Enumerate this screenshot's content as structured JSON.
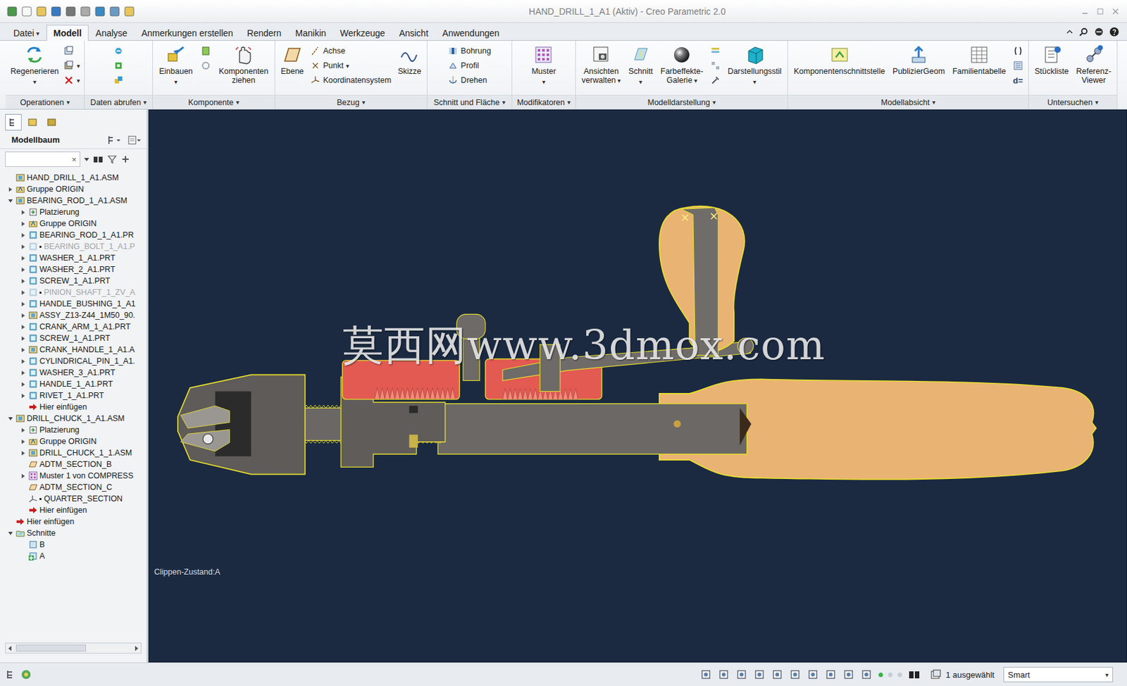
{
  "window": {
    "title": "HAND_DRILL_1_A1 (Aktiv) - Creo Parametric 2.0"
  },
  "menu_tabs": [
    {
      "label": "Datei",
      "menu": "▾",
      "selected": false
    },
    {
      "label": "Modell",
      "selected": true
    },
    {
      "label": "Analyse",
      "selected": false
    },
    {
      "label": "Anmerkungen erstellen",
      "selected": false
    },
    {
      "label": "Rendern",
      "selected": false
    },
    {
      "label": "Manikin",
      "selected": false
    },
    {
      "label": "Werkzeuge",
      "selected": false
    },
    {
      "label": "Ansicht",
      "selected": false
    },
    {
      "label": "Anwendungen",
      "selected": false
    }
  ],
  "ribbon": {
    "groups": [
      {
        "label": "Operationen",
        "menu": "▾",
        "items": [
          {
            "kind": "large",
            "label": "Regenerieren",
            "menu": "▾"
          },
          {
            "kind": "icon"
          },
          {
            "kind": "icon",
            "menu": "▾"
          },
          {
            "kind": "icon",
            "menu": "▾"
          }
        ]
      },
      {
        "label": "Daten abrufen",
        "menu": "▾",
        "items": [
          {
            "kind": "icon"
          },
          {
            "kind": "icon"
          },
          {
            "kind": "icon"
          }
        ]
      },
      {
        "label": "Komponente",
        "menu": "▾",
        "items": [
          {
            "kind": "large",
            "label": "Einbauen",
            "menu": "▾"
          },
          {
            "kind": "icon"
          },
          {
            "kind": "icon"
          },
          {
            "kind": "large",
            "label": "Komponenten\nziehen"
          }
        ]
      },
      {
        "label": "Bezug",
        "menu": "▾",
        "items": [
          {
            "kind": "large",
            "label": "Ebene"
          },
          {
            "kind": "small",
            "label": "Achse"
          },
          {
            "kind": "small",
            "label": "Punkt",
            "menu": "▾"
          },
          {
            "kind": "small",
            "label": "Koordinatensystem"
          },
          {
            "kind": "large",
            "label": "Skizze"
          }
        ]
      },
      {
        "label": "Schnitt und Fläche",
        "menu": "▾",
        "items": [
          {
            "kind": "small",
            "label": "Bohrung"
          },
          {
            "kind": "small",
            "label": "Profil"
          },
          {
            "kind": "small",
            "label": "Drehen"
          }
        ]
      },
      {
        "label": "Modifikatoren",
        "menu": "▾",
        "items": [
          {
            "kind": "large",
            "label": "Muster",
            "menu": "▾"
          }
        ]
      },
      {
        "label": "Modelldarstellung",
        "menu": "▾",
        "items": [
          {
            "kind": "large",
            "label": "Ansichten\nverwalten",
            "menu": "▾"
          },
          {
            "kind": "large",
            "label": "Schnitt",
            "menu": "▾"
          },
          {
            "kind": "large",
            "label": "Farbeffekte-\nGalerie",
            "menu": "▾"
          },
          {
            "kind": "icon"
          },
          {
            "kind": "icon"
          },
          {
            "kind": "icon"
          },
          {
            "kind": "large",
            "label": "Darstellungsstil",
            "menu": "▾"
          }
        ]
      },
      {
        "label": "Modellabsicht",
        "menu": "▾",
        "items": [
          {
            "kind": "large",
            "label": "Komponentenschnittstelle"
          },
          {
            "kind": "large",
            "label": "PublizierGeom"
          },
          {
            "kind": "large",
            "label": "Familientabelle"
          },
          {
            "kind": "icon"
          },
          {
            "kind": "icon"
          },
          {
            "kind": "glyph",
            "label": "d="
          }
        ]
      },
      {
        "label": "Untersuchen",
        "menu": "▾",
        "items": [
          {
            "kind": "large",
            "label": "Stückliste"
          },
          {
            "kind": "large",
            "label": "Referenz-\nViewer"
          }
        ]
      }
    ]
  },
  "model_tree": {
    "title": "Modellbaum",
    "search": {
      "value": "",
      "clear": "×"
    },
    "items": [
      {
        "label": "HAND_DRILL_1_A1.ASM",
        "kind": "asm",
        "level": 0,
        "expandable": false,
        "expanded": false,
        "greyed": false,
        "flag": false,
        "active": false
      },
      {
        "label": "Gruppe ORIGIN",
        "kind": "group",
        "level": 0,
        "expandable": true,
        "expanded": false,
        "greyed": false,
        "flag": false,
        "active": false
      },
      {
        "label": "BEARING_ROD_1_A1.ASM",
        "kind": "asm",
        "level": 0,
        "expandable": true,
        "expanded": true,
        "greyed": false,
        "flag": false,
        "active": false
      },
      {
        "label": "Platzierung",
        "kind": "placement",
        "level": 1,
        "expandable": true,
        "expanded": false,
        "greyed": false,
        "flag": false,
        "active": false
      },
      {
        "label": "Gruppe ORIGIN",
        "kind": "group",
        "level": 1,
        "expandable": true,
        "expanded": false,
        "greyed": false,
        "flag": false,
        "active": false
      },
      {
        "label": "BEARING_ROD_1_A1.PR",
        "kind": "prt",
        "level": 1,
        "expandable": true,
        "expanded": false,
        "greyed": false,
        "flag": false,
        "active": false
      },
      {
        "label": "BEARING_BOLT_1_A1.P",
        "kind": "prt",
        "level": 1,
        "expandable": true,
        "expanded": false,
        "greyed": true,
        "flag": true,
        "active": false
      },
      {
        "label": "WASHER_1_A1.PRT",
        "kind": "prt",
        "level": 1,
        "expandable": true,
        "expanded": false,
        "greyed": false,
        "flag": false,
        "active": false
      },
      {
        "label": "WASHER_2_A1.PRT",
        "kind": "prt",
        "level": 1,
        "expandable": true,
        "expanded": false,
        "greyed": false,
        "flag": false,
        "active": false
      },
      {
        "label": "SCREW_1_A1.PRT",
        "kind": "prt",
        "level": 1,
        "expandable": true,
        "expanded": false,
        "greyed": false,
        "flag": false,
        "active": false
      },
      {
        "label": "PINION_SHAFT_1_ZV_A",
        "kind": "prt",
        "level": 1,
        "expandable": true,
        "expanded": false,
        "greyed": true,
        "flag": true,
        "active": false
      },
      {
        "label": "HANDLE_BUSHING_1_A1",
        "kind": "prt",
        "level": 1,
        "expandable": true,
        "expanded": false,
        "greyed": false,
        "flag": false,
        "active": false
      },
      {
        "label": "ASSY_Z13-Z44_1M50_90.",
        "kind": "asm",
        "level": 1,
        "expandable": true,
        "expanded": false,
        "greyed": false,
        "flag": false,
        "active": false
      },
      {
        "label": "CRANK_ARM_1_A1.PRT",
        "kind": "prt",
        "level": 1,
        "expandable": true,
        "expanded": false,
        "greyed": false,
        "flag": false,
        "active": false
      },
      {
        "label": "SCREW_1_A1.PRT",
        "kind": "prt",
        "level": 1,
        "expandable": true,
        "expanded": false,
        "greyed": false,
        "flag": false,
        "active": false
      },
      {
        "label": "CRANK_HANDLE_1_A1.A",
        "kind": "asm",
        "level": 1,
        "expandable": true,
        "expanded": false,
        "greyed": false,
        "flag": false,
        "active": false
      },
      {
        "label": "CYLINDRICAL_PIN_1_A1.",
        "kind": "prt",
        "level": 1,
        "expandable": true,
        "expanded": false,
        "greyed": false,
        "flag": false,
        "active": false
      },
      {
        "label": "WASHER_3_A1.PRT",
        "kind": "prt",
        "level": 1,
        "expandable": true,
        "expanded": false,
        "greyed": false,
        "flag": false,
        "active": false
      },
      {
        "label": "HANDLE_1_A1.PRT",
        "kind": "prt",
        "level": 1,
        "expandable": true,
        "expanded": false,
        "greyed": false,
        "flag": false,
        "active": false
      },
      {
        "label": "RIVET_1_A1.PRT",
        "kind": "prt",
        "level": 1,
        "expandable": true,
        "expanded": false,
        "greyed": false,
        "flag": false,
        "active": false
      },
      {
        "label": "Hier einfügen",
        "kind": "insert",
        "level": 1,
        "expandable": false,
        "expanded": false,
        "greyed": false,
        "flag": false,
        "active": false
      },
      {
        "label": "DRILL_CHUCK_1_A1.ASM",
        "kind": "asm",
        "level": 0,
        "expandable": true,
        "expanded": true,
        "greyed": false,
        "flag": false,
        "active": false
      },
      {
        "label": "Platzierung",
        "kind": "placement",
        "level": 1,
        "expandable": true,
        "expanded": false,
        "greyed": false,
        "flag": false,
        "active": false
      },
      {
        "label": "Gruppe ORIGIN",
        "kind": "group",
        "level": 1,
        "expandable": true,
        "expanded": false,
        "greyed": false,
        "flag": false,
        "active": false
      },
      {
        "label": "DRILL_CHUCK_1_1.ASM",
        "kind": "asm",
        "level": 1,
        "expandable": true,
        "expanded": false,
        "greyed": false,
        "flag": false,
        "active": false
      },
      {
        "label": "ADTM_SECTION_B",
        "kind": "plane",
        "level": 1,
        "expandable": false,
        "expanded": false,
        "greyed": false,
        "flag": false,
        "active": false
      },
      {
        "label": "Muster 1 von COMPRESS",
        "kind": "pattern",
        "level": 1,
        "expandable": true,
        "expanded": false,
        "greyed": false,
        "flag": false,
        "active": false
      },
      {
        "label": "ADTM_SECTION_C",
        "kind": "plane",
        "level": 1,
        "expandable": false,
        "expanded": false,
        "greyed": false,
        "flag": false,
        "active": false
      },
      {
        "label": "QUARTER_SECTION",
        "kind": "csys",
        "level": 1,
        "expandable": false,
        "expanded": false,
        "greyed": false,
        "flag": true,
        "active": false
      },
      {
        "label": "Hier einfügen",
        "kind": "insert",
        "level": 1,
        "expandable": false,
        "expanded": false,
        "greyed": false,
        "flag": false,
        "active": false
      },
      {
        "label": "Hier einfügen",
        "kind": "insert",
        "level": 0,
        "expandable": false,
        "expanded": false,
        "greyed": false,
        "flag": false,
        "active": false
      },
      {
        "label": "Schnitte",
        "kind": "folder",
        "level": 0,
        "expandable": true,
        "expanded": true,
        "greyed": false,
        "flag": false,
        "active": false
      },
      {
        "label": "B",
        "kind": "section",
        "level": 1,
        "expandable": false,
        "expanded": false,
        "greyed": false,
        "flag": false,
        "active": false
      },
      {
        "label": "A",
        "kind": "section",
        "level": 1,
        "expandable": false,
        "expanded": false,
        "greyed": false,
        "flag": false,
        "active": true
      }
    ]
  },
  "viewport": {
    "clip_state": "Clippen-Zustand:A",
    "watermark": "莫西网www.3dmox.com"
  },
  "status_bar": {
    "selection": "1 ausgewählt",
    "filter": "Smart",
    "filter_menu": "▾"
  }
}
